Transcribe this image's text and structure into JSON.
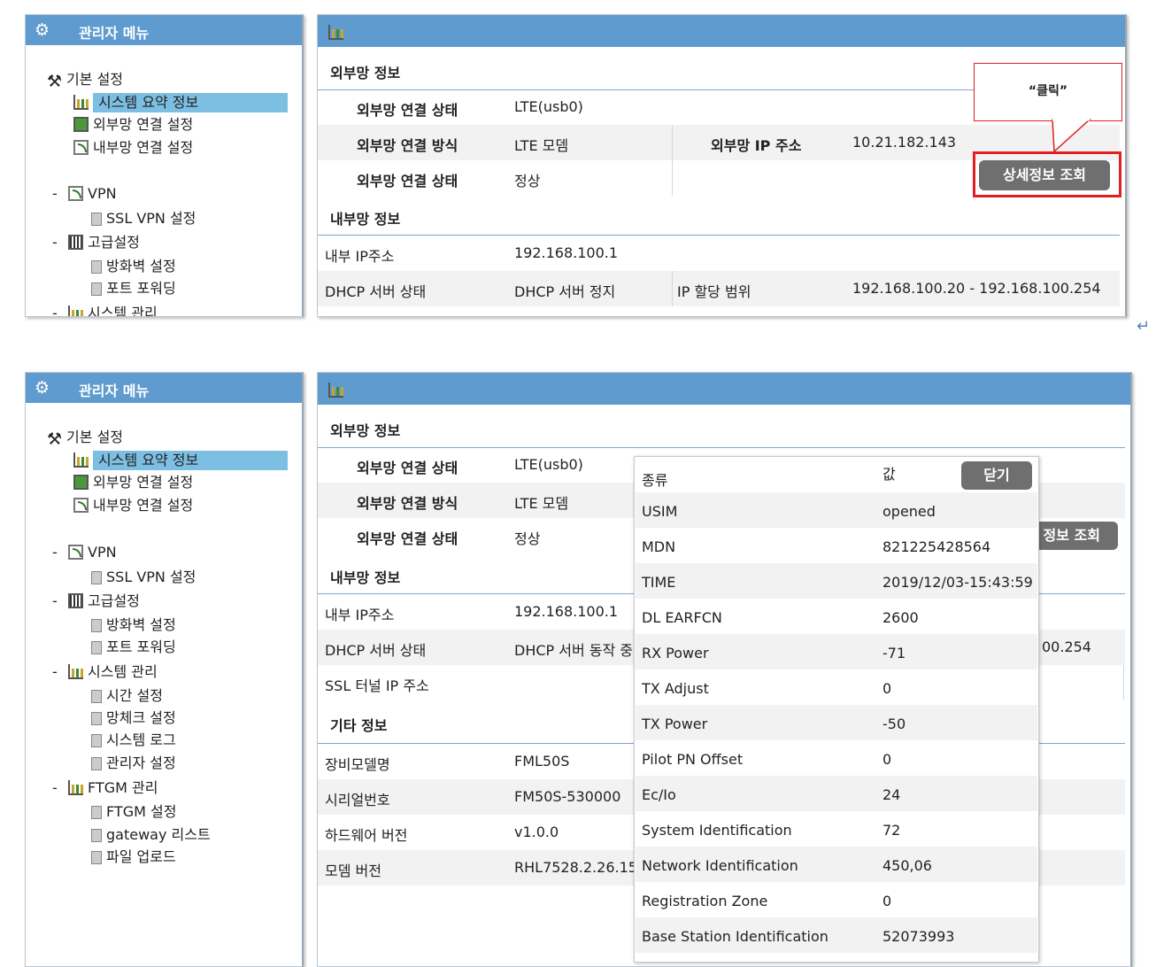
{
  "menu": {
    "title": "관리자 메뉴",
    "basic": "기본 설정",
    "summary": "시스템 요약 정보",
    "wan": "외부망 연결 설정",
    "lan": "내부망 연결 설정",
    "vpn": "VPN",
    "ssl_vpn": "SSL VPN 설정",
    "advanced": "고급설정",
    "firewall": "방화벽 설정",
    "port_forward": "포트 포워딩",
    "sys_mgmt": "시스템 관리",
    "time": "시간 설정",
    "netcheck": "망체크 설정",
    "syslog": "시스템 로그",
    "admin": "관리자 설정",
    "ftgm": "FTGM 관리",
    "ftgm_set": "FTGM 설정",
    "gateway": "gateway 리스트",
    "upload": "파일 업로드",
    "collapse": "-"
  },
  "top": {
    "wan_section": "외부망 정보",
    "wan_status_label": "외부망 연결 상태",
    "wan_status_value": "LTE(usb0)",
    "wan_method_label": "외부망 연결 방식",
    "wan_method_value": "LTE 모뎀",
    "wan_ip_label": "외부망 IP 주소",
    "wan_ip_value": "10.21.182.143",
    "wan_state_label": "외부망 연결 상태",
    "wan_state_value": "정상",
    "detail_button": "상세정보 조회",
    "callout": "“클릭”",
    "lan_section": "내부망 정보",
    "lan_ip_label": "내부 IP주소",
    "lan_ip_value": "192.168.100.1",
    "dhcp_label": "DHCP 서버 상태",
    "dhcp_value": "DHCP 서버 정지",
    "range_label": "IP 할당 범위",
    "range_value": "192.168.100.20 - 192.168.100.254"
  },
  "bottom": {
    "wan_section": "외부망 정보",
    "wan_status_label": "외부망 연결 상태",
    "wan_status_value": "LTE(usb0)",
    "wan_method_label": "외부망 연결 방식",
    "wan_method_value": "LTE 모뎀",
    "wan_state_label": "외부망 연결 상태",
    "wan_state_value": "정상",
    "detail_button_partial": "정보 조회",
    "lan_section": "내부망 정보",
    "lan_ip_label": "내부 IP주소",
    "lan_ip_value": "192.168.100.1",
    "dhcp_label": "DHCP 서버 상태",
    "dhcp_value": "DHCP 서버 동작 중",
    "range_partial": "00.254",
    "ssl_label": "SSL 터널 IP 주소",
    "etc_section": "기타 정보",
    "model_label": "장비모델명",
    "model_value": "FML50S",
    "serial_label": "시리얼번호",
    "serial_value": "FM50S-530000",
    "hw_label": "하드웨어 버전",
    "hw_value": "v1.0.0",
    "modem_label": "모뎀 버전",
    "modem_value": "RHL7528.2.26.15"
  },
  "popup": {
    "header_key": "종류",
    "header_value": "값",
    "close_button": "닫기",
    "rows": [
      {
        "k": "USIM",
        "v": "opened"
      },
      {
        "k": "MDN",
        "v": "821225428564"
      },
      {
        "k": "TIME",
        "v": "2019/12/03-15:43:59"
      },
      {
        "k": "DL EARFCN",
        "v": "2600"
      },
      {
        "k": "RX Power",
        "v": "-71"
      },
      {
        "k": "TX Adjust",
        "v": "0"
      },
      {
        "k": "TX Power",
        "v": "-50"
      },
      {
        "k": "Pilot PN Offset",
        "v": "0"
      },
      {
        "k": "Ec/Io",
        "v": "24"
      },
      {
        "k": "System Identification",
        "v": "72"
      },
      {
        "k": "Network Identification",
        "v": "450,06"
      },
      {
        "k": "Registration Zone",
        "v": "0"
      },
      {
        "k": "Base Station Identification",
        "v": "52073993"
      }
    ]
  },
  "colors": {
    "header_blue": "#5f9bcf",
    "selection": "#7cbfe3",
    "highlight_red": "#e02020",
    "button_gray": "#6f6f6f"
  },
  "icons": [
    "gear-icon",
    "tools-icon",
    "chart-icon",
    "monitor-icon",
    "network-icon",
    "grid-icon",
    "document-icon",
    "return-icon"
  ]
}
